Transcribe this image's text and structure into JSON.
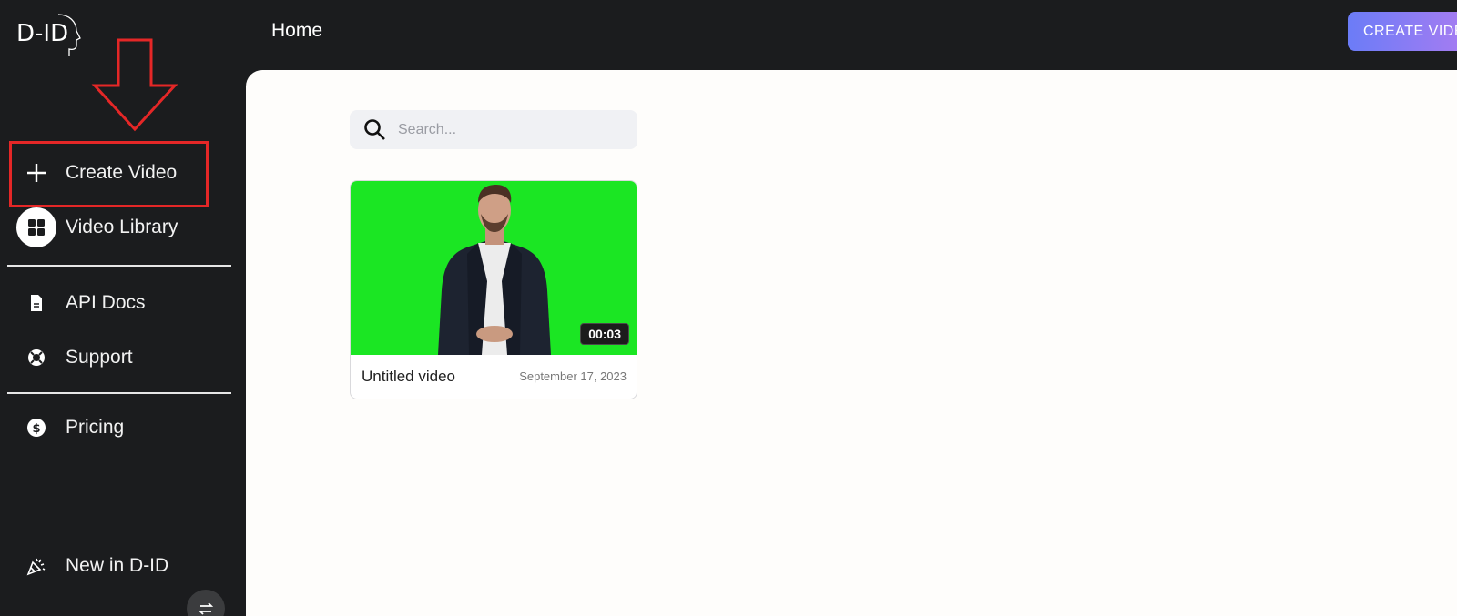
{
  "logo": {
    "text": "D-ID"
  },
  "header": {
    "title": "Home",
    "create_button": "CREATE VIDEO"
  },
  "sidebar": {
    "items": [
      {
        "label": "Create Video",
        "icon": "plus-icon"
      },
      {
        "label": "Video Library",
        "icon": "grid-icon"
      },
      {
        "label": "API Docs",
        "icon": "document-icon"
      },
      {
        "label": "Support",
        "icon": "lifebuoy-icon"
      },
      {
        "label": "Pricing",
        "icon": "dollar-icon"
      },
      {
        "label": "New in D-ID",
        "icon": "party-popper-icon"
      }
    ]
  },
  "search": {
    "placeholder": "Search...",
    "value": ""
  },
  "videos": [
    {
      "title": "Untitled video",
      "date": "September 17, 2023",
      "duration": "00:03"
    }
  ],
  "colors": {
    "sidebar_bg": "#1b1c1e",
    "annotation": "#e52727",
    "thumb_bg": "#1be623",
    "create_gradient": [
      "#6b7cf7",
      "#b47cf0"
    ]
  }
}
